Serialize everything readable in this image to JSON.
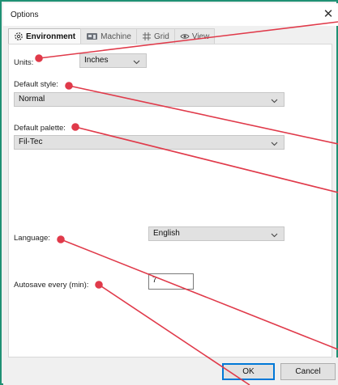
{
  "window": {
    "title": "Options",
    "close_glyph": "✕"
  },
  "tabs": [
    {
      "label": "Environment",
      "icon": "environment-icon",
      "active": true
    },
    {
      "label": "Machine",
      "icon": "machine-icon",
      "active": false
    },
    {
      "label": "Grid",
      "icon": "grid-icon",
      "active": false
    },
    {
      "label": "View",
      "icon": "view-icon",
      "active": false
    }
  ],
  "settings": {
    "units": {
      "label": "Units:",
      "value": "Inches"
    },
    "default_style": {
      "label": "Default style:",
      "value": "Normal"
    },
    "default_palette": {
      "label": "Default palette:",
      "value": "Fil-Tec"
    },
    "language": {
      "label": "Language:",
      "value": "English"
    },
    "autosave": {
      "label": "Autosave every (min):",
      "value": "7"
    }
  },
  "buttons": {
    "ok": "OK",
    "cancel": "Cancel"
  },
  "colors": {
    "frame": "#1f9174",
    "callout": "#e03a4a",
    "accent": "#0078d7"
  }
}
